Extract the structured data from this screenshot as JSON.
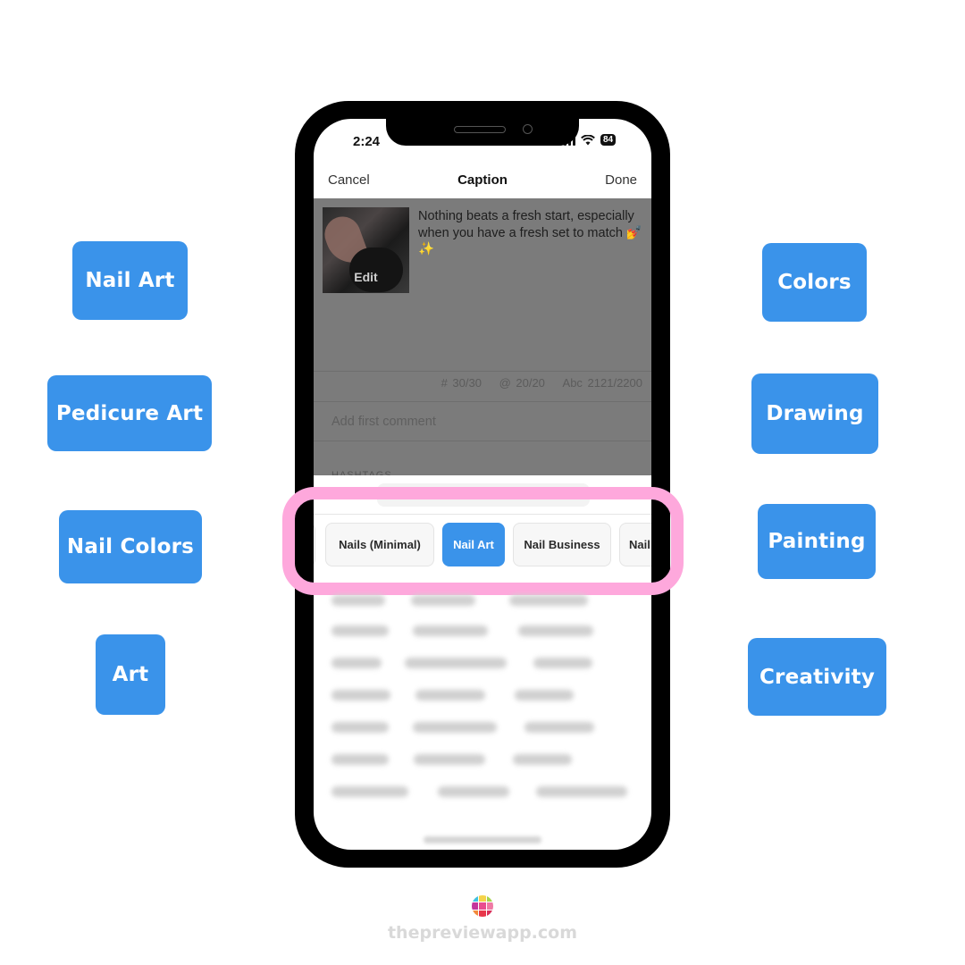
{
  "side_tags_left": [
    "Nail Art",
    "Pedicure Art",
    "Nail Colors",
    "Art"
  ],
  "side_tags_right": [
    "Colors",
    "Drawing",
    "Painting",
    "Creativity"
  ],
  "status_bar": {
    "time": "2:24",
    "battery": "84",
    "icons": [
      "signal-icon",
      "wifi-icon",
      "battery-icon"
    ]
  },
  "nav": {
    "cancel": "Cancel",
    "title": "Caption",
    "done": "Done"
  },
  "post": {
    "thumbnail_label": "Edit",
    "caption": "Nothing beats a fresh start, especially when you have a fresh set to match 💅✨"
  },
  "counters": {
    "hashtags": "# 30/30",
    "mentions": "@ 20/20",
    "characters": "Abc 2121/2200"
  },
  "comment_placeholder": "Add first comment",
  "hashtags_label": "HASHTAGS",
  "chips": [
    {
      "label": "Nails (Minimal)",
      "active": false
    },
    {
      "label": "Nail Art",
      "active": true
    },
    {
      "label": "Nail Business",
      "active": false
    },
    {
      "label": "Nail",
      "active": false
    }
  ],
  "colors": {
    "accent": "#3a93ea",
    "highlight": "#fea8dc",
    "dim_overlay": "#7b7b7b"
  },
  "footer": {
    "website": "thepreviewapp.com"
  }
}
